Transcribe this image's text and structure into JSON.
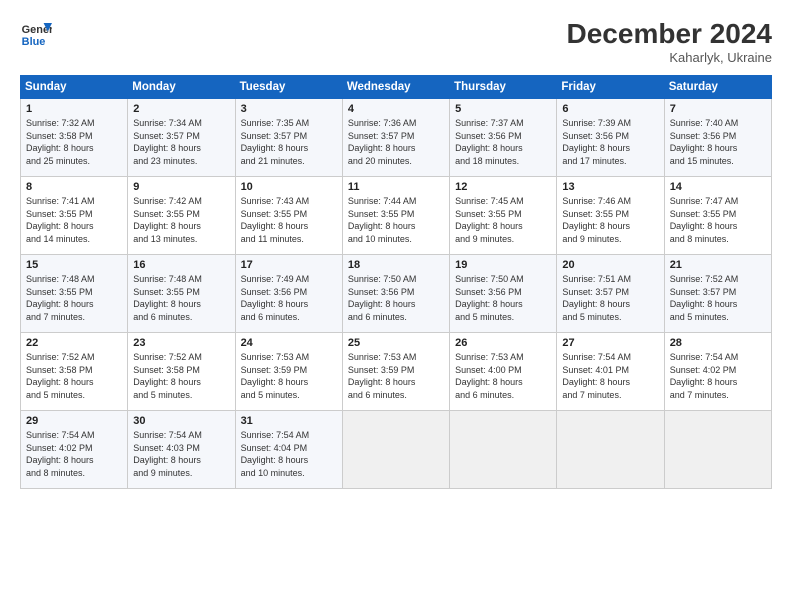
{
  "header": {
    "logo_line1": "General",
    "logo_line2": "Blue",
    "month": "December 2024",
    "location": "Kaharlyk, Ukraine"
  },
  "days_of_week": [
    "Sunday",
    "Monday",
    "Tuesday",
    "Wednesday",
    "Thursday",
    "Friday",
    "Saturday"
  ],
  "weeks": [
    [
      {
        "day": "1",
        "sunrise": "7:32 AM",
        "sunset": "3:58 PM",
        "daylight": "8 hours and 25 minutes."
      },
      {
        "day": "2",
        "sunrise": "7:34 AM",
        "sunset": "3:57 PM",
        "daylight": "8 hours and 23 minutes."
      },
      {
        "day": "3",
        "sunrise": "7:35 AM",
        "sunset": "3:57 PM",
        "daylight": "8 hours and 21 minutes."
      },
      {
        "day": "4",
        "sunrise": "7:36 AM",
        "sunset": "3:57 PM",
        "daylight": "8 hours and 20 minutes."
      },
      {
        "day": "5",
        "sunrise": "7:37 AM",
        "sunset": "3:56 PM",
        "daylight": "8 hours and 18 minutes."
      },
      {
        "day": "6",
        "sunrise": "7:39 AM",
        "sunset": "3:56 PM",
        "daylight": "8 hours and 17 minutes."
      },
      {
        "day": "7",
        "sunrise": "7:40 AM",
        "sunset": "3:56 PM",
        "daylight": "8 hours and 15 minutes."
      }
    ],
    [
      {
        "day": "8",
        "sunrise": "7:41 AM",
        "sunset": "3:55 PM",
        "daylight": "8 hours and 14 minutes."
      },
      {
        "day": "9",
        "sunrise": "7:42 AM",
        "sunset": "3:55 PM",
        "daylight": "8 hours and 13 minutes."
      },
      {
        "day": "10",
        "sunrise": "7:43 AM",
        "sunset": "3:55 PM",
        "daylight": "8 hours and 11 minutes."
      },
      {
        "day": "11",
        "sunrise": "7:44 AM",
        "sunset": "3:55 PM",
        "daylight": "8 hours and 10 minutes."
      },
      {
        "day": "12",
        "sunrise": "7:45 AM",
        "sunset": "3:55 PM",
        "daylight": "8 hours and 9 minutes."
      },
      {
        "day": "13",
        "sunrise": "7:46 AM",
        "sunset": "3:55 PM",
        "daylight": "8 hours and 9 minutes."
      },
      {
        "day": "14",
        "sunrise": "7:47 AM",
        "sunset": "3:55 PM",
        "daylight": "8 hours and 8 minutes."
      }
    ],
    [
      {
        "day": "15",
        "sunrise": "7:48 AM",
        "sunset": "3:55 PM",
        "daylight": "8 hours and 7 minutes."
      },
      {
        "day": "16",
        "sunrise": "7:48 AM",
        "sunset": "3:55 PM",
        "daylight": "8 hours and 6 minutes."
      },
      {
        "day": "17",
        "sunrise": "7:49 AM",
        "sunset": "3:56 PM",
        "daylight": "8 hours and 6 minutes."
      },
      {
        "day": "18",
        "sunrise": "7:50 AM",
        "sunset": "3:56 PM",
        "daylight": "8 hours and 6 minutes."
      },
      {
        "day": "19",
        "sunrise": "7:50 AM",
        "sunset": "3:56 PM",
        "daylight": "8 hours and 5 minutes."
      },
      {
        "day": "20",
        "sunrise": "7:51 AM",
        "sunset": "3:57 PM",
        "daylight": "8 hours and 5 minutes."
      },
      {
        "day": "21",
        "sunrise": "7:52 AM",
        "sunset": "3:57 PM",
        "daylight": "8 hours and 5 minutes."
      }
    ],
    [
      {
        "day": "22",
        "sunrise": "7:52 AM",
        "sunset": "3:58 PM",
        "daylight": "8 hours and 5 minutes."
      },
      {
        "day": "23",
        "sunrise": "7:52 AM",
        "sunset": "3:58 PM",
        "daylight": "8 hours and 5 minutes."
      },
      {
        "day": "24",
        "sunrise": "7:53 AM",
        "sunset": "3:59 PM",
        "daylight": "8 hours and 5 minutes."
      },
      {
        "day": "25",
        "sunrise": "7:53 AM",
        "sunset": "3:59 PM",
        "daylight": "8 hours and 6 minutes."
      },
      {
        "day": "26",
        "sunrise": "7:53 AM",
        "sunset": "4:00 PM",
        "daylight": "8 hours and 6 minutes."
      },
      {
        "day": "27",
        "sunrise": "7:54 AM",
        "sunset": "4:01 PM",
        "daylight": "8 hours and 7 minutes."
      },
      {
        "day": "28",
        "sunrise": "7:54 AM",
        "sunset": "4:02 PM",
        "daylight": "8 hours and 7 minutes."
      }
    ],
    [
      {
        "day": "29",
        "sunrise": "7:54 AM",
        "sunset": "4:02 PM",
        "daylight": "8 hours and 8 minutes."
      },
      {
        "day": "30",
        "sunrise": "7:54 AM",
        "sunset": "4:03 PM",
        "daylight": "8 hours and 9 minutes."
      },
      {
        "day": "31",
        "sunrise": "7:54 AM",
        "sunset": "4:04 PM",
        "daylight": "8 hours and 10 minutes."
      },
      null,
      null,
      null,
      null
    ]
  ]
}
